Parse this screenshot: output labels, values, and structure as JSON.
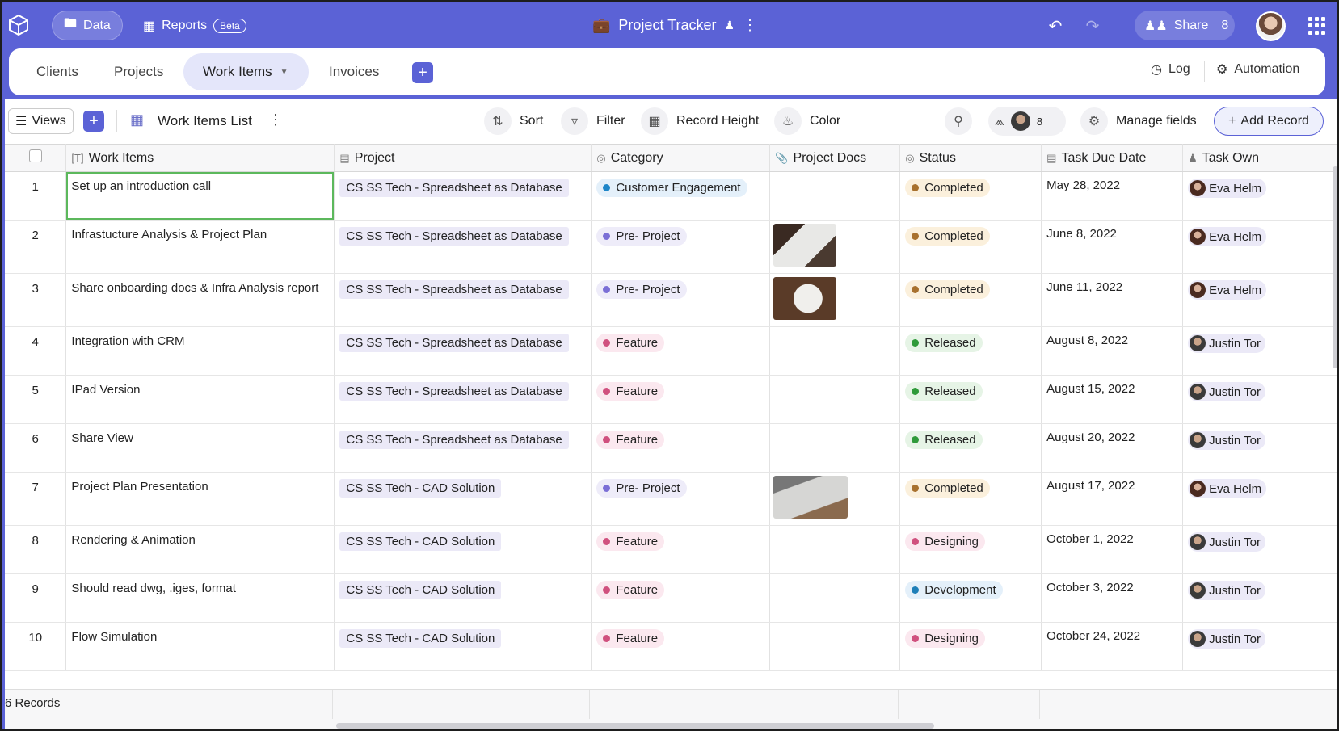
{
  "topbar": {
    "data_label": "Data",
    "reports_label": "Reports",
    "beta_label": "Beta",
    "title": "Project Tracker",
    "share_label": "Share",
    "share_count": "8"
  },
  "tabs": [
    {
      "label": "Clients"
    },
    {
      "label": "Projects"
    },
    {
      "label": "Work Items"
    },
    {
      "label": "Invoices"
    }
  ],
  "tabbar_right": {
    "log_label": "Log",
    "automation_label": "Automation"
  },
  "toolbar": {
    "views_label": "Views",
    "view_name": "Work Items List",
    "sort_label": "Sort",
    "filter_label": "Filter",
    "record_height_label": "Record Height",
    "color_label": "Color",
    "collab_count": "8",
    "manage_fields_label": "Manage fields",
    "add_record_label": "Add Record"
  },
  "columns": {
    "work_items": "Work Items",
    "project": "Project",
    "category": "Category",
    "project_docs": "Project Docs",
    "status": "Status",
    "task_due_date": "Task Due Date",
    "task_owner": "Task Own"
  },
  "colors": {
    "accent": "#5b62d6",
    "customer_engagement": "#1e86c8",
    "pre_project": "#7b6fd6",
    "feature": "#d0507e",
    "completed": "#a8712e",
    "released": "#2f9a3a",
    "designing": "#d0507e",
    "development": "#1e7fb8"
  },
  "rows": [
    {
      "num": "1",
      "item": "Set up an introduction call",
      "project": "CS SS Tech - Spreadsheet as Database",
      "category": "Customer Engagement",
      "cat_color": "#1e86c8",
      "cat_bg": "#e4f0fa",
      "doc": "",
      "status": "Completed",
      "st_color": "#a8712e",
      "st_bg": "#fbf0dc",
      "due": "May 28, 2022",
      "owner": "Eva Helm",
      "owner_av": "eva"
    },
    {
      "num": "2",
      "item": "Infrastucture Analysis & Project Plan",
      "project": "CS SS Tech - Spreadsheet as Database",
      "category": "Pre- Project",
      "cat_color": "#7b6fd6",
      "cat_bg": "#eeecf9",
      "doc": "doc1",
      "status": "Completed",
      "st_color": "#a8712e",
      "st_bg": "#fbf0dc",
      "due": "June 8, 2022",
      "owner": "Eva Helm",
      "owner_av": "eva"
    },
    {
      "num": "3",
      "item": "Share onboarding docs & Infra Analysis report",
      "project": "CS SS Tech - Spreadsheet as Database",
      "category": "Pre- Project",
      "cat_color": "#7b6fd6",
      "cat_bg": "#eeecf9",
      "doc": "doc2",
      "status": "Completed",
      "st_color": "#a8712e",
      "st_bg": "#fbf0dc",
      "due": "June 11, 2022",
      "owner": "Eva Helm",
      "owner_av": "eva"
    },
    {
      "num": "4",
      "item": "Integration with CRM",
      "project": "CS SS Tech - Spreadsheet as Database",
      "category": "Feature",
      "cat_color": "#d0507e",
      "cat_bg": "#fbe8ef",
      "doc": "",
      "status": "Released",
      "st_color": "#2f9a3a",
      "st_bg": "#e6f4e6",
      "due": "August 8, 2022",
      "owner": "Justin Tor",
      "owner_av": "justin"
    },
    {
      "num": "5",
      "item": "IPad Version",
      "project": "CS SS Tech - Spreadsheet as Database",
      "category": "Feature",
      "cat_color": "#d0507e",
      "cat_bg": "#fbe8ef",
      "doc": "",
      "status": "Released",
      "st_color": "#2f9a3a",
      "st_bg": "#e6f4e6",
      "due": "August 15, 2022",
      "owner": "Justin Tor",
      "owner_av": "justin"
    },
    {
      "num": "6",
      "item": "Share View",
      "project": "CS SS Tech - Spreadsheet as Database",
      "category": "Feature",
      "cat_color": "#d0507e",
      "cat_bg": "#fbe8ef",
      "doc": "",
      "status": "Released",
      "st_color": "#2f9a3a",
      "st_bg": "#e6f4e6",
      "due": "August 20, 2022",
      "owner": "Justin Tor",
      "owner_av": "justin"
    },
    {
      "num": "7",
      "item": "Project Plan Presentation",
      "project": "CS SS Tech - CAD Solution",
      "category": "Pre- Project",
      "cat_color": "#7b6fd6",
      "cat_bg": "#eeecf9",
      "doc": "doc3",
      "status": "Completed",
      "st_color": "#a8712e",
      "st_bg": "#fbf0dc",
      "due": "August 17, 2022",
      "owner": "Eva Helm",
      "owner_av": "eva"
    },
    {
      "num": "8",
      "item": "Rendering & Animation",
      "project": "CS SS Tech - CAD Solution",
      "category": "Feature",
      "cat_color": "#d0507e",
      "cat_bg": "#fbe8ef",
      "doc": "",
      "status": "Designing",
      "st_color": "#d0507e",
      "st_bg": "#fbe8ef",
      "due": "October 1, 2022",
      "owner": "Justin Tor",
      "owner_av": "justin"
    },
    {
      "num": "9",
      "item": "Should read dwg, .iges, format",
      "project": "CS SS Tech - CAD Solution",
      "category": "Feature",
      "cat_color": "#d0507e",
      "cat_bg": "#fbe8ef",
      "doc": "",
      "status": "Development",
      "st_color": "#1e7fb8",
      "st_bg": "#e4f0fa",
      "due": "October 3, 2022",
      "owner": "Justin Tor",
      "owner_av": "justin"
    },
    {
      "num": "10",
      "item": "Flow Simulation",
      "project": "CS SS Tech - CAD Solution",
      "category": "Feature",
      "cat_color": "#d0507e",
      "cat_bg": "#fbe8ef",
      "doc": "",
      "status": "Designing",
      "st_color": "#d0507e",
      "st_bg": "#fbe8ef",
      "due": "October 24, 2022",
      "owner": "Justin Tor",
      "owner_av": "justin"
    }
  ],
  "footer": {
    "records_label": "6 Records"
  }
}
